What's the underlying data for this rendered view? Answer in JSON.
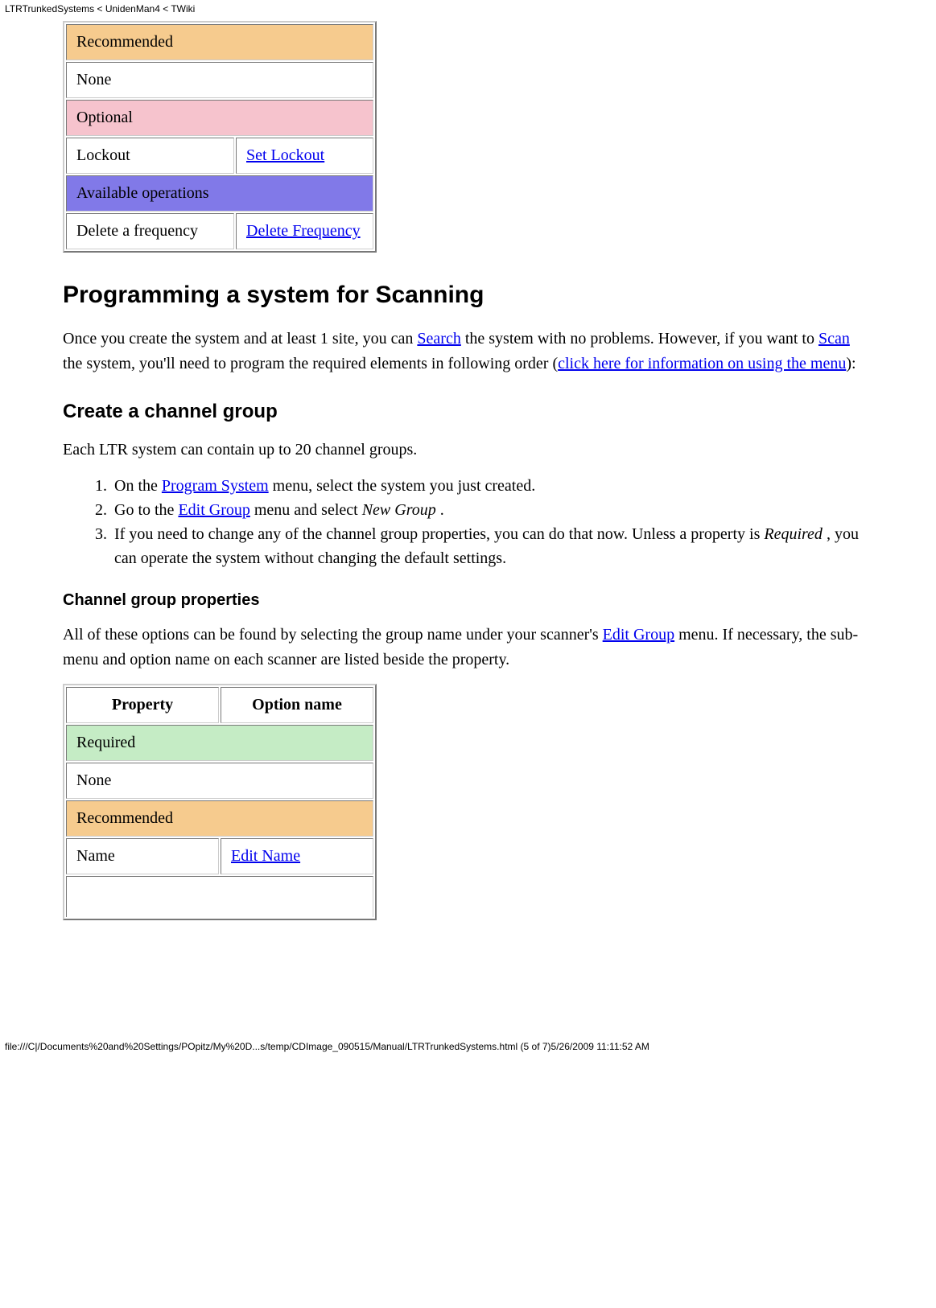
{
  "header": {
    "breadcrumb": "LTRTrunkedSystems < UnidenMan4 < TWiki"
  },
  "table1": {
    "sec_recommended": "Recommended",
    "row_rec_none": "None",
    "sec_optional": "Optional",
    "row_opt_label": "Lockout",
    "row_opt_link": "Set Lockout",
    "sec_available": "Available operations",
    "row_av_label": "Delete a frequency",
    "row_av_link": "Delete Frequency"
  },
  "section1": {
    "heading": "Programming a system for Scanning",
    "p1_a": "Once you create the system and at least 1 site, you can ",
    "p1_link1": "Search",
    "p1_b": " the system with no problems. However, if you want to ",
    "p1_link2": "Scan",
    "p1_c": " the system, you'll need to program the required elements in following order (",
    "p1_link3": "click here for information on using the menu",
    "p1_d": "):"
  },
  "section2": {
    "heading": "Create a channel group",
    "intro": "Each LTR system can contain up to 20 channel groups.",
    "li1_a": "On the ",
    "li1_link": "Program System",
    "li1_b": " menu, select the system you just created.",
    "li2_a": "Go to the ",
    "li2_link": "Edit Group",
    "li2_b": " menu and select ",
    "li2_em": "New Group",
    "li2_c": " .",
    "li3_a": "If you need to change any of the channel group properties, you can do that now. Unless a property is ",
    "li3_em": "Required",
    "li3_b": " , you can operate the system without changing the default settings."
  },
  "section3": {
    "heading": "Channel group properties",
    "p_a": "All of these options can be found by selecting the group name under your scanner's ",
    "p_link": "Edit Group",
    "p_b": " menu. If necessary, the sub-menu and option name on each scanner are listed beside the property."
  },
  "table2": {
    "col1": "Property",
    "col2": "Option name",
    "sec_required": "Required",
    "row_req_none": "None",
    "sec_recommended": "Recommended",
    "row_rec_label": "Name",
    "row_rec_link": "Edit Name"
  },
  "footer": {
    "path": "file:///C|/Documents%20and%20Settings/POpitz/My%20D...s/temp/CDImage_090515/Manual/LTRTrunkedSystems.html (5 of 7)5/26/2009 11:11:52 AM"
  }
}
